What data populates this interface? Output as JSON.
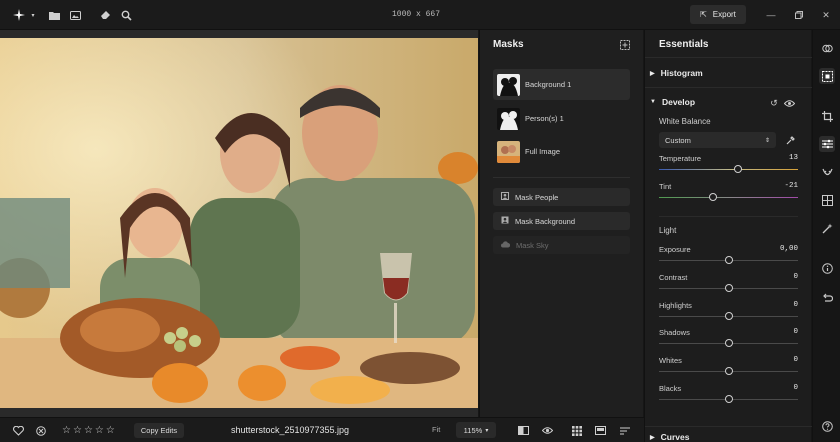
{
  "topbar": {
    "dimensions": "1000 x 667",
    "export_label": "Export",
    "icons": [
      "app-logo-icon",
      "folder-icon",
      "image-icon",
      "eraser-icon",
      "magic-search-icon"
    ]
  },
  "masks_panel": {
    "title": "Masks",
    "items": [
      {
        "label": "Background 1",
        "selected": true
      },
      {
        "label": "Person(s) 1",
        "selected": false
      },
      {
        "label": "Full Image",
        "selected": false
      }
    ],
    "buttons": [
      {
        "label": "Mask People",
        "enabled": true
      },
      {
        "label": "Mask Background",
        "enabled": true
      },
      {
        "label": "Mask Sky",
        "enabled": false
      }
    ]
  },
  "essentials": {
    "title": "Essentials",
    "histogram": "Histogram",
    "develop": "Develop",
    "white_balance": "White Balance",
    "wb_preset": "Custom",
    "temperature": {
      "label": "Temperature",
      "value": "13",
      "pos": 0.57
    },
    "tint": {
      "label": "Tint",
      "value": "-21",
      "pos": 0.39
    },
    "light": "Light",
    "light_sliders": [
      {
        "label": "Exposure",
        "value": "0,00",
        "pos": 0.5
      },
      {
        "label": "Contrast",
        "value": "0",
        "pos": 0.5
      },
      {
        "label": "Highlights",
        "value": "0",
        "pos": 0.5
      },
      {
        "label": "Shadows",
        "value": "0",
        "pos": 0.5
      },
      {
        "label": "Whites",
        "value": "0",
        "pos": 0.5
      },
      {
        "label": "Blacks",
        "value": "0",
        "pos": 0.5
      }
    ],
    "curves": "Curves"
  },
  "bottombar": {
    "copy_edits": "Copy Edits",
    "filename": "shutterstock_2510977355.jpg",
    "fit": "Fit",
    "zoom": "115%",
    "rating": 0
  },
  "colors": {
    "accent": "#ffffff",
    "panel": "#1d1d1d",
    "knob_border": "#cfcfcf"
  }
}
